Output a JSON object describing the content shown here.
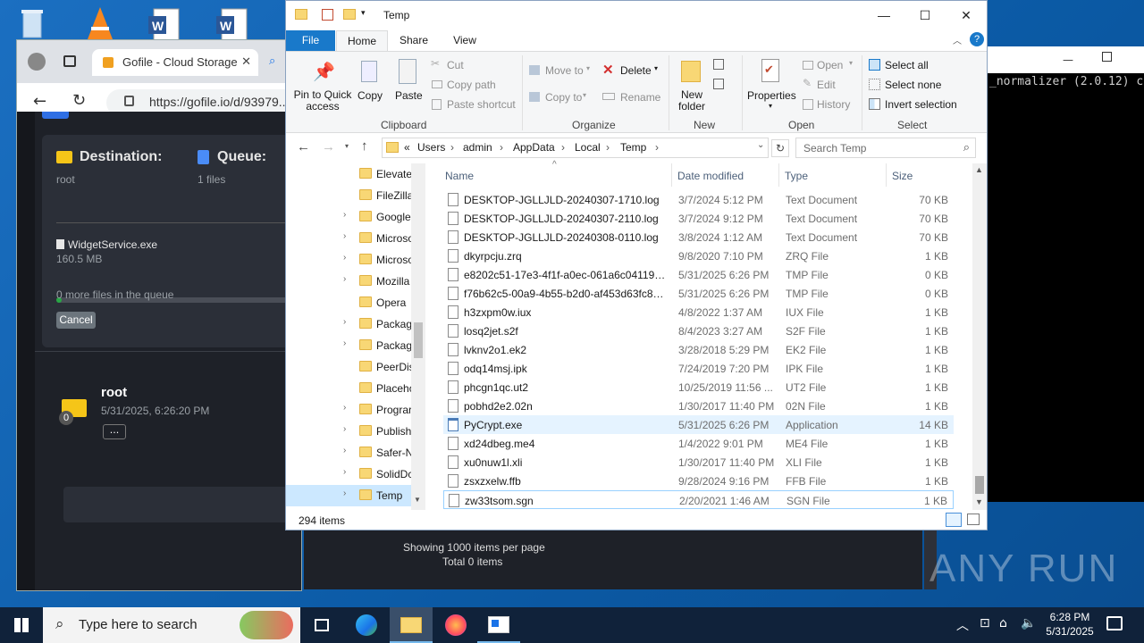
{
  "browser": {
    "tab_title": "Gofile - Cloud Storage",
    "url": "https://gofile.io/d/93979...",
    "upload": {
      "destination_label": "Destination:",
      "destination_value": "root",
      "queue_label": "Queue:",
      "queue_value": "1 files",
      "file_name": "WidgetService.exe",
      "file_size": "160.5 MB",
      "queue_note": "0 more files in the queue",
      "cancel_label": "Cancel",
      "progress": 0.02
    },
    "folder": {
      "name": "root",
      "badge": "0",
      "date": "5/31/2025, 6:26:20 PM",
      "more_label": "..."
    },
    "footer": {
      "per_page": "Showing 1000 items per page",
      "total": "Total 0 items"
    }
  },
  "explorer": {
    "title": "Temp",
    "ribbon_tabs": [
      "File",
      "Home",
      "Share",
      "View"
    ],
    "clipboard": {
      "pin": "Pin to Quick access",
      "copy": "Copy",
      "paste": "Paste",
      "cut": "Cut",
      "copy_path": "Copy path",
      "paste_shortcut": "Paste shortcut",
      "group": "Clipboard"
    },
    "organize": {
      "move_to": "Move to",
      "copy_to": "Copy to",
      "delete": "Delete",
      "rename": "Rename",
      "group": "Organize"
    },
    "new": {
      "new_folder": "New folder",
      "group": "New"
    },
    "open": {
      "properties": "Properties",
      "open": "Open",
      "edit": "Edit",
      "history": "History",
      "group": "Open"
    },
    "select": {
      "select_all": "Select all",
      "select_none": "Select none",
      "invert": "Invert selection",
      "group": "Select"
    },
    "breadcrumb": [
      "Users",
      "admin",
      "AppData",
      "Local",
      "Temp"
    ],
    "breadcrumb_prefix": "«",
    "search_placeholder": "Search Temp",
    "nav_items": [
      "Elevate",
      "FileZilla",
      "Google",
      "Microso",
      "Microso",
      "Mozilla",
      "Opera",
      "Packag",
      "Packag",
      "PeerDis",
      "Placeho",
      "Prograr",
      "Publish",
      "Safer-N",
      "SolidDc",
      "Temp"
    ],
    "columns": {
      "name": "Name",
      "date": "Date modified",
      "type": "Type",
      "size": "Size"
    },
    "files": [
      {
        "name": "DESKTOP-JGLLJLD-20240307-1710.log",
        "date": "3/7/2024 5:12 PM",
        "type": "Text Document",
        "size": "70 KB"
      },
      {
        "name": "DESKTOP-JGLLJLD-20240307-2110.log",
        "date": "3/7/2024 9:12 PM",
        "type": "Text Document",
        "size": "70 KB"
      },
      {
        "name": "DESKTOP-JGLLJLD-20240308-0110.log",
        "date": "3/8/2024 1:12 AM",
        "type": "Text Document",
        "size": "70 KB"
      },
      {
        "name": "dkyrpcju.zrq",
        "date": "9/8/2020 7:10 PM",
        "type": "ZRQ File",
        "size": "1 KB"
      },
      {
        "name": "e8202c51-17e3-4f1f-a0ec-061a6c041190.t...",
        "date": "5/31/2025 6:26 PM",
        "type": "TMP File",
        "size": "0 KB"
      },
      {
        "name": "f76b62c5-00a9-4b55-b2d0-af453d63fc8b....",
        "date": "5/31/2025 6:26 PM",
        "type": "TMP File",
        "size": "0 KB"
      },
      {
        "name": "h3zxpm0w.iux",
        "date": "4/8/2022 1:37 AM",
        "type": "IUX File",
        "size": "1 KB"
      },
      {
        "name": "losq2jet.s2f",
        "date": "8/4/2023 3:27 AM",
        "type": "S2F File",
        "size": "1 KB"
      },
      {
        "name": "lvknv2o1.ek2",
        "date": "3/28/2018 5:29 PM",
        "type": "EK2 File",
        "size": "1 KB"
      },
      {
        "name": "odq14msj.ipk",
        "date": "7/24/2019 7:20 PM",
        "type": "IPK File",
        "size": "1 KB"
      },
      {
        "name": "phcgn1qc.ut2",
        "date": "10/25/2019 11:56 ...",
        "type": "UT2 File",
        "size": "1 KB"
      },
      {
        "name": "pobhd2e2.02n",
        "date": "1/30/2017 11:40 PM",
        "type": "02N File",
        "size": "1 KB"
      },
      {
        "name": "PyCrypt.exe",
        "date": "5/31/2025 6:26 PM",
        "type": "Application",
        "size": "14 KB"
      },
      {
        "name": "xd24dbeg.me4",
        "date": "1/4/2022 9:01 PM",
        "type": "ME4 File",
        "size": "1 KB"
      },
      {
        "name": "xu0nuw1l.xli",
        "date": "1/30/2017 11:40 PM",
        "type": "XLI File",
        "size": "1 KB"
      },
      {
        "name": "zsxzxelw.ffb",
        "date": "9/28/2024 9:16 PM",
        "type": "FFB File",
        "size": "1 KB"
      },
      {
        "name": "zw33tsom.sgn",
        "date": "2/20/2021 1:46 AM",
        "type": "SGN File",
        "size": "1 KB"
      }
    ],
    "status_count": "294 items"
  },
  "terminal": {
    "text": "_normalizer (2.0.12) c"
  },
  "taskbar": {
    "search_placeholder": "Type here to search",
    "time": "6:28 PM",
    "date": "5/31/2025"
  },
  "watermark": "ANY RUN",
  "colors": {
    "explorer_accent": "#1979ca",
    "gofile_bg": "#1e2128",
    "progress_fill": "#28a745",
    "selection": "#cce8ff"
  }
}
